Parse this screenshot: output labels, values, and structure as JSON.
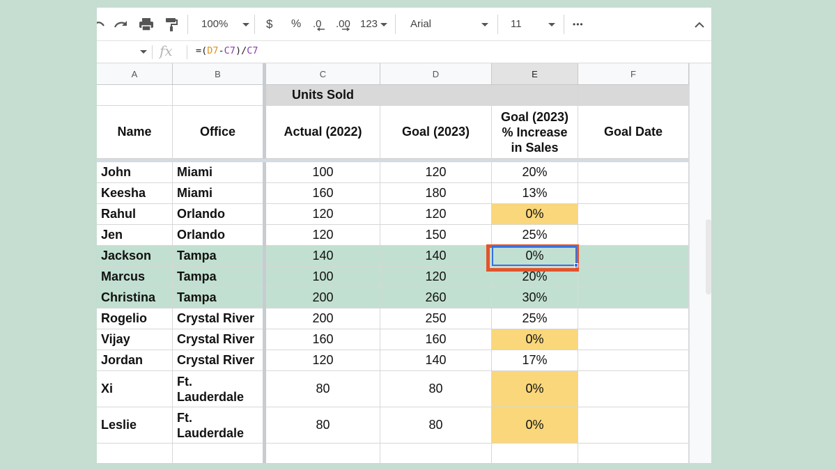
{
  "toolbar": {
    "zoom": "100%",
    "currency_symbol": "$",
    "percent_symbol": "%",
    "decrease_decimal": ".0",
    "increase_decimal": ".00",
    "more_formats": "123",
    "font_name": "Arial",
    "font_size": "11",
    "more": "•••"
  },
  "formula_bar": {
    "fx_label": "fx",
    "formula_parts": [
      "=(",
      "D7",
      "-",
      "C7",
      ")/",
      "C7"
    ]
  },
  "columns": [
    "A",
    "B",
    "C",
    "D",
    "E",
    "F"
  ],
  "selected_column": "E",
  "headers": {
    "group_units_sold": "Units Sold",
    "name": "Name",
    "office": "Office",
    "actual": "Actual (2022)",
    "goal": "Goal (2023)",
    "pct_increase": "Goal (2023) % Increase in Sales",
    "goal_date": "Goal Date"
  },
  "rows": [
    {
      "name": "John",
      "office": "Miami",
      "actual": "100",
      "goal": "120",
      "pct": "20%",
      "highlight": "",
      "pct_fill": ""
    },
    {
      "name": "Keesha",
      "office": "Miami",
      "actual": "160",
      "goal": "180",
      "pct": "13%",
      "highlight": "",
      "pct_fill": ""
    },
    {
      "name": "Rahul",
      "office": "Orlando",
      "actual": "120",
      "goal": "120",
      "pct": "0%",
      "highlight": "",
      "pct_fill": "yellow"
    },
    {
      "name": "Jen",
      "office": "Orlando",
      "actual": "120",
      "goal": "150",
      "pct": "25%",
      "highlight": "",
      "pct_fill": ""
    },
    {
      "name": "Jackson",
      "office": "Tampa",
      "actual": "140",
      "goal": "140",
      "pct": "0%",
      "highlight": "green",
      "pct_fill": ""
    },
    {
      "name": "Marcus",
      "office": "Tampa",
      "actual": "100",
      "goal": "120",
      "pct": "20%",
      "highlight": "green",
      "pct_fill": ""
    },
    {
      "name": "Christina",
      "office": "Tampa",
      "actual": "200",
      "goal": "260",
      "pct": "30%",
      "highlight": "green",
      "pct_fill": ""
    },
    {
      "name": "Rogelio",
      "office": "Crystal River",
      "actual": "200",
      "goal": "250",
      "pct": "25%",
      "highlight": "",
      "pct_fill": ""
    },
    {
      "name": "Vijay",
      "office": "Crystal River",
      "actual": "160",
      "goal": "160",
      "pct": "0%",
      "highlight": "",
      "pct_fill": "yellow"
    },
    {
      "name": "Jordan",
      "office": "Crystal River",
      "actual": "120",
      "goal": "140",
      "pct": "17%",
      "highlight": "",
      "pct_fill": ""
    },
    {
      "name": "Xi",
      "office": "Ft. Lauderdale",
      "actual": "80",
      "goal": "80",
      "pct": "0%",
      "highlight": "",
      "pct_fill": "yellow"
    },
    {
      "name": "Leslie",
      "office": "Ft. Lauderdale",
      "actual": "80",
      "goal": "80",
      "pct": "0%",
      "highlight": "",
      "pct_fill": "yellow"
    }
  ],
  "colors": {
    "background": "#c6ddd1",
    "green_highlight": "#c2e0d1",
    "yellow_highlight": "#f9d77a",
    "header_gray": "#d9d9d9",
    "selection_outline": "#e2542b",
    "selection_inner": "#3571e0"
  }
}
